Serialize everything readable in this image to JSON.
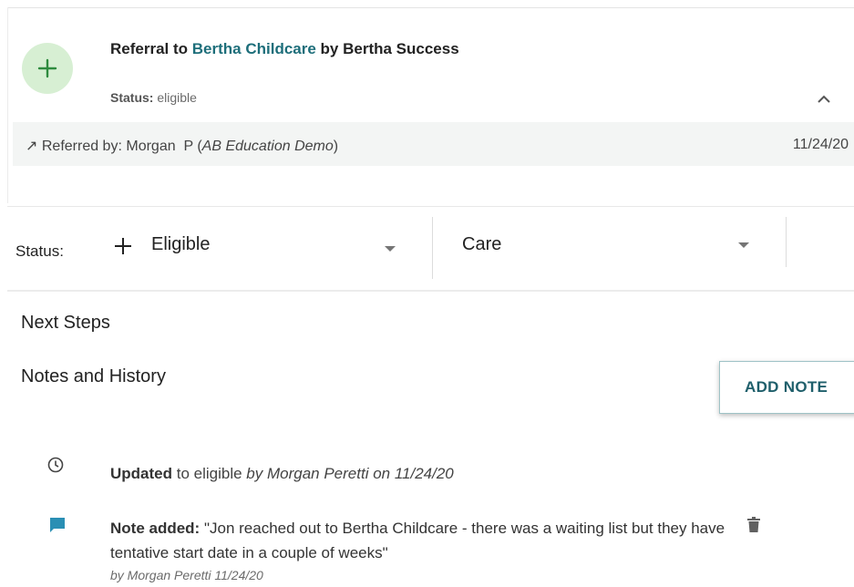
{
  "referral": {
    "title_prefix": "Referral to",
    "provider": "Bertha Childcare",
    "title_suffix": "by Bertha Success",
    "status_label": "Status:",
    "status_value": "eligible",
    "referred_by_label": "Referred by:",
    "referrer_name": "Morgan  P",
    "referrer_org": "AB Education Demo",
    "date": "11/24/20"
  },
  "status_row": {
    "label": "Status:",
    "primary_value": "Eligible",
    "secondary_value": "Care"
  },
  "sections": {
    "next_steps": "Next Steps",
    "notes_history": "Notes and History",
    "add_note_label": "ADD NOTE"
  },
  "history": [
    {
      "action": "Updated",
      "detail": "to eligible",
      "meta": "by Morgan Peretti on 11/24/20"
    },
    {
      "action": "Note added:",
      "text": "\"Jon reached out to Bertha Childcare - there was a waiting list but they have tentative start date in a couple of weeks\"",
      "meta": "by Morgan Peretti 11/24/20"
    }
  ],
  "icons": {
    "avatar": "plus-icon",
    "collapse": "chevron-up-icon",
    "referred": "arrow-up-right-icon",
    "status_add": "plus-icon",
    "history_update": "clock-icon",
    "history_note": "comment-icon",
    "delete": "trash-icon"
  },
  "colors": {
    "accent": "#1d6e7a",
    "avatar_bg": "#d7efd3",
    "avatar_plus": "#2e8b3e",
    "comment_icon": "#2a8fb4",
    "referred_band": "#f3f5f4"
  }
}
